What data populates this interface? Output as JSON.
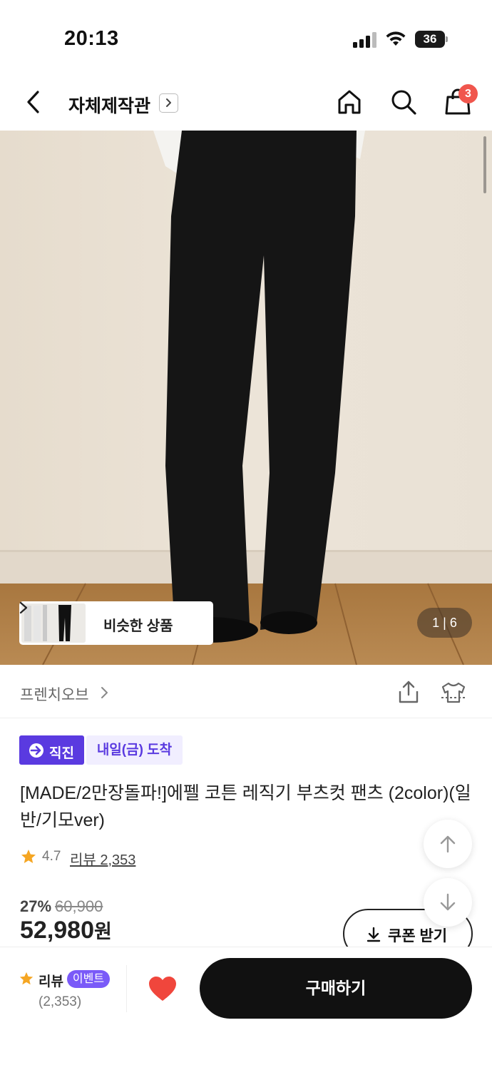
{
  "status_bar": {
    "time": "20:13",
    "battery": "36"
  },
  "nav": {
    "store_title": "자체제작관",
    "cart_count": "3"
  },
  "hero": {
    "similar_label": "비슷한 상품",
    "page_indicator": "1 | 6"
  },
  "brand": {
    "name": "프렌치오브"
  },
  "badges": {
    "direct": "직진",
    "arrival": "내일(금) 도착"
  },
  "product": {
    "title": "[MADE/2만장돌파!]에펠 코튼 레직기 부츠컷 팬츠 (2color)(일반/기모ver)",
    "rating": "4.7",
    "review_link": "리뷰 2,353",
    "discount_rate": "27%",
    "original_price": "60,900",
    "sale_price": "52,980",
    "currency_unit": "원",
    "coupon_label": "쿠폰 받기"
  },
  "bottom_bar": {
    "review_label": "리뷰",
    "event_badge": "이벤트",
    "review_count": "(2,353)",
    "buy_label": "구매하기"
  },
  "colors": {
    "accent_purple": "#5a3ae0",
    "badge_red": "#f0564d",
    "heart_red": "#f0463c",
    "star_orange": "#f5a623",
    "buy_button": "#111111"
  },
  "icons": [
    "back-icon",
    "home-icon",
    "search-icon",
    "cart-icon",
    "share-icon",
    "fitting-icon",
    "star-icon",
    "heart-icon",
    "download-icon",
    "arrow-up-icon",
    "arrow-down-icon",
    "plane-icon"
  ]
}
